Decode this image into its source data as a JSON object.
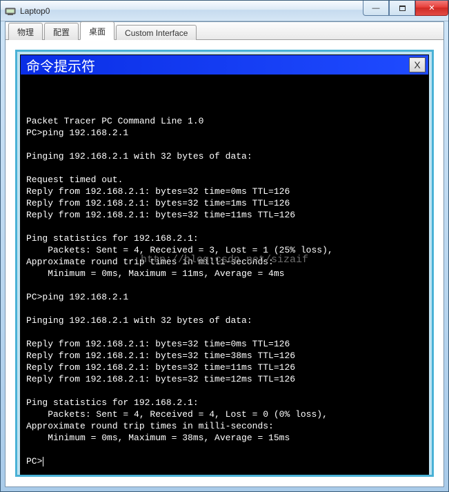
{
  "window": {
    "title": "Laptop0"
  },
  "window_buttons": {
    "min": "—",
    "close": "✕"
  },
  "tabs": {
    "items": [
      "物理",
      "配置",
      "桌面",
      "Custom Interface"
    ],
    "active_index": 2
  },
  "cmd": {
    "title": "命令提示符",
    "close_label": "X",
    "lines": [
      "",
      "Packet Tracer PC Command Line 1.0",
      "PC>ping 192.168.2.1",
      "",
      "Pinging 192.168.2.1 with 32 bytes of data:",
      "",
      "Request timed out.",
      "Reply from 192.168.2.1: bytes=32 time=0ms TTL=126",
      "Reply from 192.168.2.1: bytes=32 time=1ms TTL=126",
      "Reply from 192.168.2.1: bytes=32 time=11ms TTL=126",
      "",
      "Ping statistics for 192.168.2.1:",
      "    Packets: Sent = 4, Received = 3, Lost = 1 (25% loss),",
      "Approximate round trip times in milli-seconds:",
      "    Minimum = 0ms, Maximum = 11ms, Average = 4ms",
      "",
      "PC>ping 192.168.2.1",
      "",
      "Pinging 192.168.2.1 with 32 bytes of data:",
      "",
      "Reply from 192.168.2.1: bytes=32 time=0ms TTL=126",
      "Reply from 192.168.2.1: bytes=32 time=38ms TTL=126",
      "Reply from 192.168.2.1: bytes=32 time=11ms TTL=126",
      "Reply from 192.168.2.1: bytes=32 time=12ms TTL=126",
      "",
      "Ping statistics for 192.168.2.1:",
      "    Packets: Sent = 4, Received = 4, Lost = 0 (0% loss),",
      "Approximate round trip times in milli-seconds:",
      "    Minimum = 0ms, Maximum = 38ms, Average = 15ms",
      "",
      "PC>"
    ],
    "prompt_trailing": true
  },
  "watermark": "http://blog.csdn.net/sizaif"
}
